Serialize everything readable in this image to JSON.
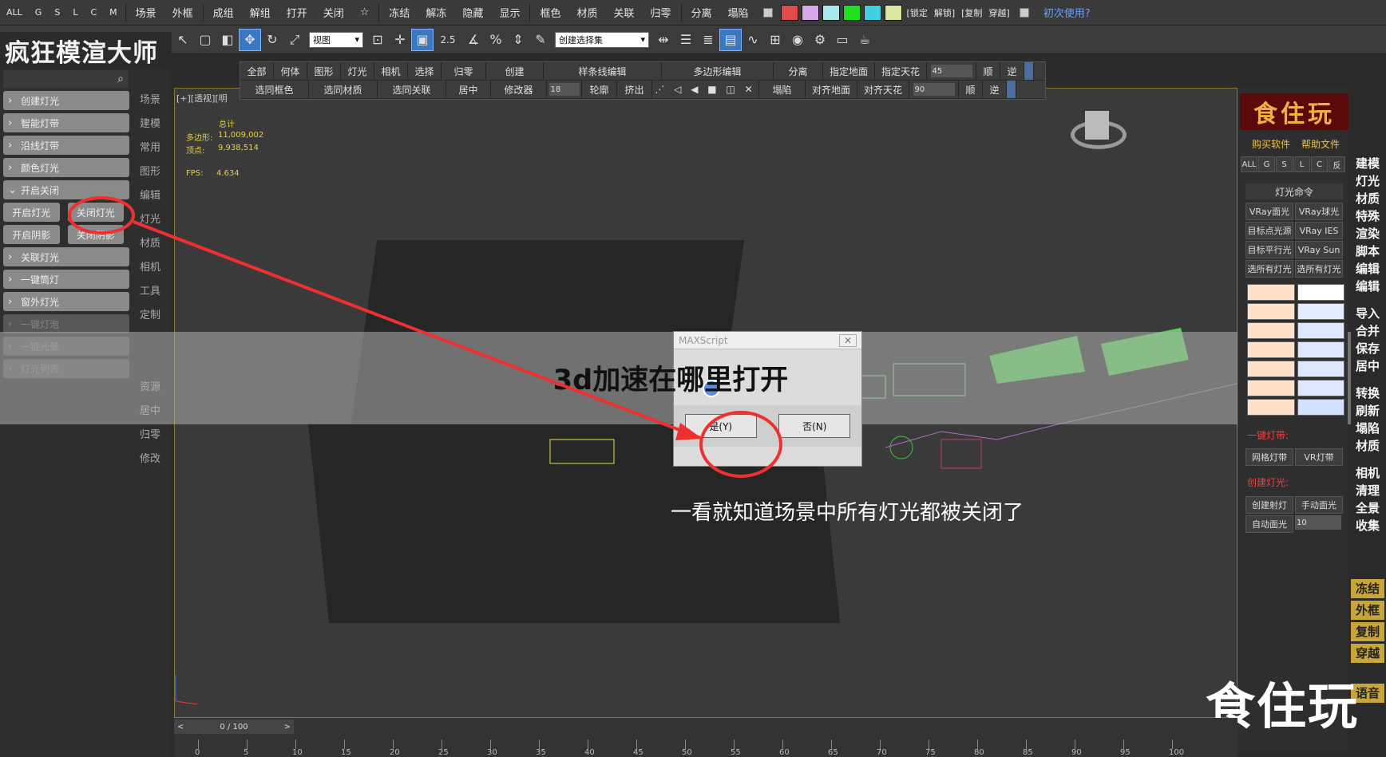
{
  "topbar": {
    "filters": [
      "ALL",
      "G",
      "S",
      "L",
      "C",
      "M"
    ],
    "menu1": [
      "场景",
      "外框"
    ],
    "menu2": [
      "成组",
      "解组",
      "打开",
      "关闭",
      "☆"
    ],
    "menu3": [
      "冻结",
      "解冻",
      "隐藏",
      "显示"
    ],
    "menu4": [
      "框色",
      "材质",
      "关联",
      "归零"
    ],
    "menu5": [
      "分离",
      "塌陷"
    ],
    "swatch_colors": [
      "#e04a4a",
      "#d8a8e8",
      "#a8e8e8",
      "#20e020",
      "#40d0e0",
      "#d8e8a0"
    ],
    "bracket_items": [
      "[锁定",
      "解锁]",
      "[复制",
      "穿越]"
    ],
    "first_use": "初次使用?"
  },
  "toolbar": {
    "view_select": "视图",
    "selection_set": "创建选择集",
    "snap_angle": "2.5"
  },
  "brand": "疯狂模渲大师",
  "cmdbar": {
    "row1": [
      "全部",
      "何体",
      "图形",
      "灯光",
      "相机",
      "选择",
      "归零",
      "创建",
      "样条线编辑",
      "多边形编辑",
      "分离",
      "指定地面",
      "指定天花"
    ],
    "row1_spin": "45",
    "row1_end": [
      "顺",
      "逆"
    ],
    "row2": [
      "选同框色",
      "选同材质",
      "选同关联",
      "居中",
      "修改器"
    ],
    "row2_spin_a": "18",
    "row2_mid": [
      "轮廓",
      "挤出"
    ],
    "row2_right": [
      "塌陷",
      "对齐地面",
      "对齐天花"
    ],
    "row2_spin_b": "90",
    "row2_end": [
      "顺",
      "逆"
    ]
  },
  "leftpanel": {
    "items_top": [
      "创建灯光",
      "智能灯带",
      "沿线灯带",
      "颜色灯光",
      "开启关闭"
    ],
    "pair1": [
      "开启灯光",
      "关闭灯光"
    ],
    "pair2": [
      "开启阴影",
      "关闭阴影"
    ],
    "items_bottom": [
      "关联灯光",
      "一键筒灯",
      "窗外灯光"
    ],
    "items_dim": [
      "一键灯泡",
      "一键光晕",
      "灯光列表"
    ]
  },
  "vstrip": {
    "top": [
      "场景",
      "建模",
      "常用",
      "图形",
      "编辑",
      "灯光",
      "材质",
      "相机",
      "工具",
      "定制"
    ],
    "bottom": [
      "资源",
      "居中",
      "归零",
      "修改"
    ]
  },
  "viewport": {
    "label": "[+][透视][明",
    "stats_title": "总计",
    "poly_label": "多边形:",
    "poly_value": "11,009,002",
    "vert_label": "顶点:",
    "vert_value": "9,938,514",
    "fps_label": "FPS:",
    "fps_value": "4.634"
  },
  "headline": "3d加速在哪里打开",
  "dialog": {
    "title": "MAXScript",
    "yes": "是(Y)",
    "no": "否(N)"
  },
  "caption": "一看就知道场景中所有灯光都被关闭了",
  "watermark": "食住玩",
  "rightpanel": {
    "banner": "食住玩",
    "buy": "购买软件",
    "help": "帮助文件",
    "filters": [
      "ALL",
      "G",
      "S",
      "L",
      "C",
      "反"
    ],
    "group_title": "灯光命令",
    "lights": [
      "VRay面光",
      "VRay球光",
      "目标点光源",
      "VRay IES",
      "目标平行光",
      "VRay Sun",
      "选所有灯光",
      "选所有灯光"
    ],
    "strip_head": "一键灯带:",
    "strip_btns": [
      "网格灯带",
      "VR灯带"
    ],
    "create_head": "创建灯光:",
    "create_btns": [
      "创建射灯",
      "手动面光",
      "自动面光"
    ],
    "create_spin": "10"
  },
  "farright": {
    "a": [
      "建模",
      "灯光",
      "材质",
      "特殊",
      "渲染",
      "脚本",
      "编辑",
      "编辑"
    ],
    "b": [
      "导入",
      "合并",
      "保存",
      "居中"
    ],
    "c": [
      "转换",
      "刷新",
      "塌陷",
      "材质"
    ],
    "d": [
      "相机",
      "清理",
      "全景",
      "收集"
    ],
    "gold": [
      "冻结",
      "外框",
      "复制",
      "穿越"
    ],
    "last": "语音"
  },
  "timeline": {
    "range": "0 / 100",
    "ticks": [
      "0",
      "5",
      "10",
      "15",
      "20",
      "25",
      "30",
      "35",
      "40",
      "45",
      "50",
      "55",
      "60",
      "65",
      "70",
      "75",
      "80",
      "85",
      "90",
      "95",
      "100"
    ]
  }
}
